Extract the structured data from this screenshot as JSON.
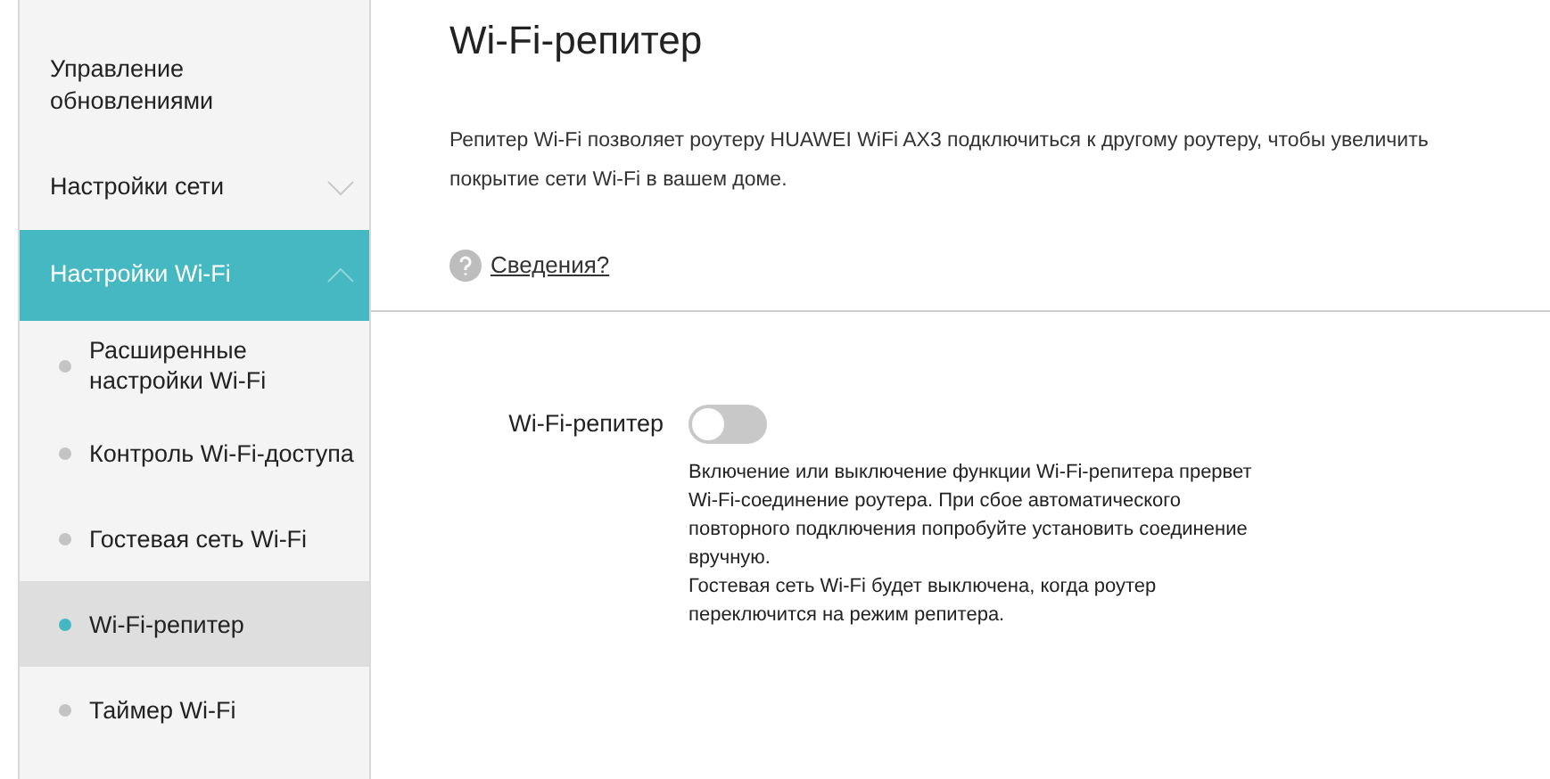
{
  "sidebar": {
    "items": [
      {
        "label": "Управление обновлениями",
        "kind": "link"
      },
      {
        "label": "Настройки сети",
        "kind": "group",
        "expanded": false
      },
      {
        "label": "Настройки Wi-Fi",
        "kind": "group",
        "expanded": true,
        "children": [
          {
            "label": "Расширенные настройки Wi-Fi",
            "selected": false
          },
          {
            "label": "Контроль Wi-Fi-доступа",
            "selected": false
          },
          {
            "label": "Гостевая сеть Wi-Fi",
            "selected": false
          },
          {
            "label": "Wi-Fi-репитер",
            "selected": true
          },
          {
            "label": "Таймер Wi-Fi",
            "selected": false
          }
        ]
      }
    ]
  },
  "page": {
    "title": "Wi-Fi-репитер",
    "description": "Репитер Wi-Fi позволяет роутеру HUAWEI WiFi AX3 подключиться к другому роутеру, чтобы увеличить покрытие сети Wi-Fi в вашем доме.",
    "help_link": "Сведения?"
  },
  "setting": {
    "label": "Wi-Fi-репитер",
    "on": false,
    "notes": [
      "Включение или выключение функции Wi-Fi-репитера прервет Wi-Fi-соединение роутера. При сбое автоматического повторного подключения попробуйте установить соединение вручную.",
      "Гостевая сеть Wi-Fi будет выключена, когда роутер переключится на режим репитера."
    ]
  }
}
